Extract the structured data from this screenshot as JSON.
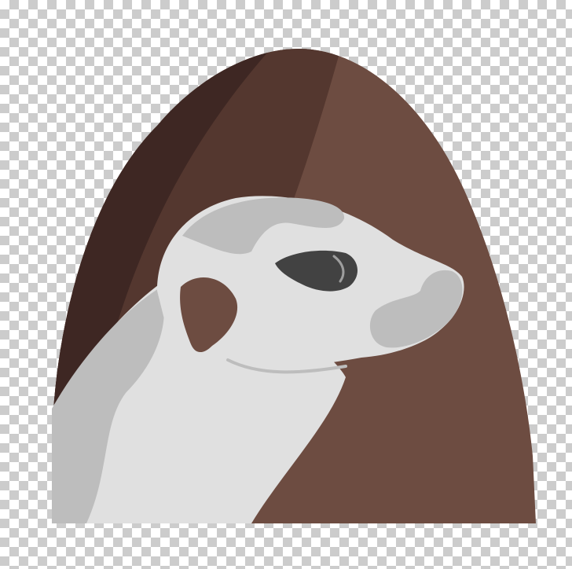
{
  "illustration": {
    "subject": "meerkat-in-burrow",
    "background_pattern": "transparency-checkerboard",
    "colors": {
      "checker_light": "#ffffff",
      "checker_dark": "#cccccc",
      "mound_dark": "#3e2723",
      "mound_mid": "#54372f",
      "mound_light": "#6d4c41",
      "fur_light": "#e0e0e0",
      "fur_shadow": "#bdbdbd",
      "eye": "#424242",
      "ear": "#6d4c41"
    }
  }
}
